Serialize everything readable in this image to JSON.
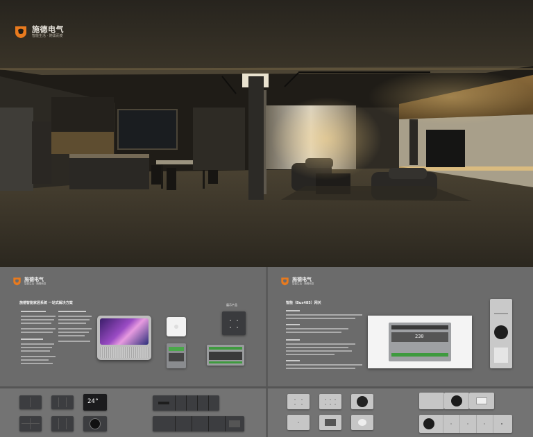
{
  "brand": {
    "name": "施德电气",
    "slogan": "智能生活 · 随需而变",
    "accent_color": "#e87a1e"
  },
  "panel_left": {
    "brand_name": "施德电气",
    "brand_slogan": "智能生活 · 随需而变",
    "title": "施德智能家居系统 一站式解决方案",
    "tag": "展示产品"
  },
  "panel_right": {
    "brand_name": "施德电气",
    "brand_slogan": "智能生活 · 随需而变",
    "title": "智能（Bus485）网关",
    "module_readout": "230"
  },
  "thermostat": {
    "reading": "24°"
  }
}
